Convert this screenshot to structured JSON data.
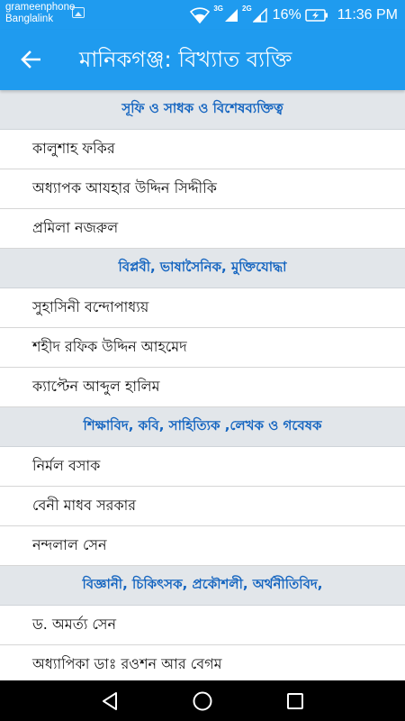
{
  "status_bar": {
    "carrier_1": "grameenphone",
    "carrier_2": "Banglalink",
    "net_1": "3G",
    "net_2": "2G",
    "battery_percent": "16%",
    "time": "11:36 PM"
  },
  "app_bar": {
    "back_icon": "arrow-back-icon",
    "title": "মানিকগঞ্জ: বিখ্যাত ব্যক্তি"
  },
  "sections": [
    {
      "header": "সূফি ও সাধক ও বিশেষব্যক্তিত্ব",
      "items": [
        "কালুশাহ ফকির",
        "অধ্যাপক আযহার উদ্দিন সিদ্দীকি",
        "প্রমিলা নজরুল"
      ]
    },
    {
      "header": "বিপ্লবী, ভাষাসৈনিক, মুক্তিযোদ্ধা",
      "items": [
        "সুহাসিনী বন্দোপাধ্যয়",
        "শহীদ রফিক উদ্দিন আহমেদ",
        "ক্যাপ্টেন আব্দুল হালিম"
      ]
    },
    {
      "header": "শিক্ষাবিদ, কবি, সাহিত্যিক ,লেখক ও গবেষক",
      "items": [
        "নির্মল বসাক",
        "বেনী মাধব সরকার",
        "নন্দলাল সেন"
      ]
    },
    {
      "header": "বিজ্ঞানী, চিকিৎসক, প্রকৌশলী, অর্থনীতিবিদ,",
      "items": [
        "ড. অমর্ত্য সেন",
        "অধ্যাপিকা ডাঃ রওশন আর বেগম"
      ]
    }
  ],
  "nav_bar": {
    "back": "triangle-back-icon",
    "home": "circle-home-icon",
    "recents": "square-recents-icon"
  },
  "colors": {
    "primary": "#1f9bef",
    "section_text": "#1565c0",
    "section_bg": "#e2e6ea"
  }
}
